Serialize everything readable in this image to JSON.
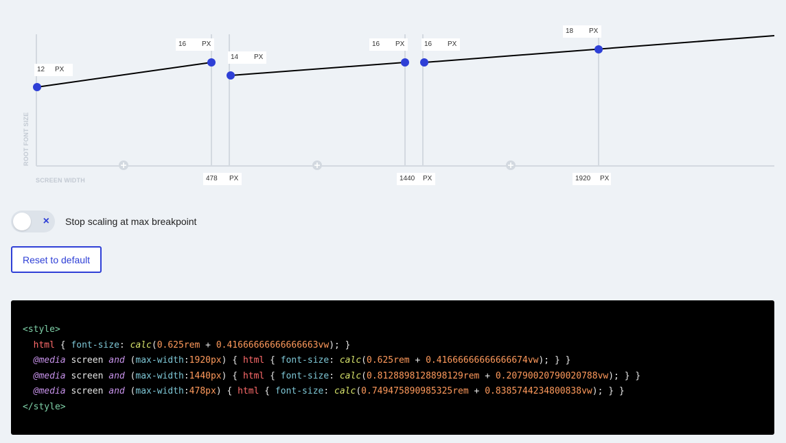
{
  "graph": {
    "y_axis_label": "ROOT FONT SIZE",
    "x_axis_label": "SCREEN WIDTH",
    "unit": "PX",
    "point_labels": [
      {
        "value": "12",
        "unit": "PX"
      },
      {
        "value": "16",
        "unit": "PX"
      },
      {
        "value": "14",
        "unit": "PX"
      },
      {
        "value": "16",
        "unit": "PX"
      },
      {
        "value": "16",
        "unit": "PX"
      },
      {
        "value": "18",
        "unit": "PX"
      }
    ],
    "breakpoints": [
      {
        "value": "478",
        "unit": "PX"
      },
      {
        "value": "1440",
        "unit": "PX"
      },
      {
        "value": "1920",
        "unit": "PX"
      }
    ],
    "colors": {
      "line": "#000000",
      "point": "#2e3fd6",
      "axis": "#d3d9e0",
      "add": "#d3d9e0"
    },
    "icons": {
      "add": "plus-circle-icon"
    }
  },
  "toggle": {
    "label": "Stop scaling at max breakpoint",
    "state": "off",
    "icon": "close-icon",
    "glyph": "×"
  },
  "reset_button": {
    "label": "Reset to default"
  },
  "code": {
    "open_tag": "<style>",
    "close_tag": "</style>",
    "base": {
      "selector": "html",
      "property": "font-size",
      "fn": "calc",
      "a": "0.625rem",
      "op": "+",
      "b": "0.41666666666666663vw"
    },
    "media": [
      {
        "at": "@media",
        "type": "screen",
        "and": "and",
        "feature": "max-width",
        "value": "1920px",
        "selector": "html",
        "property": "font-size",
        "fn": "calc",
        "a": "0.625rem",
        "op": "+",
        "b": "0.41666666666666674vw"
      },
      {
        "at": "@media",
        "type": "screen",
        "and": "and",
        "feature": "max-width",
        "value": "1440px",
        "selector": "html",
        "property": "font-size",
        "fn": "calc",
        "a": "0.8128898128898129rem",
        "op": "+",
        "b": "0.20790020790020788vw"
      },
      {
        "at": "@media",
        "type": "screen",
        "and": "and",
        "feature": "max-width",
        "value": "478px",
        "selector": "html",
        "property": "font-size",
        "fn": "calc",
        "a": "0.749475890985325rem",
        "op": "+",
        "b": "0.8385744234800838vw"
      }
    ]
  }
}
